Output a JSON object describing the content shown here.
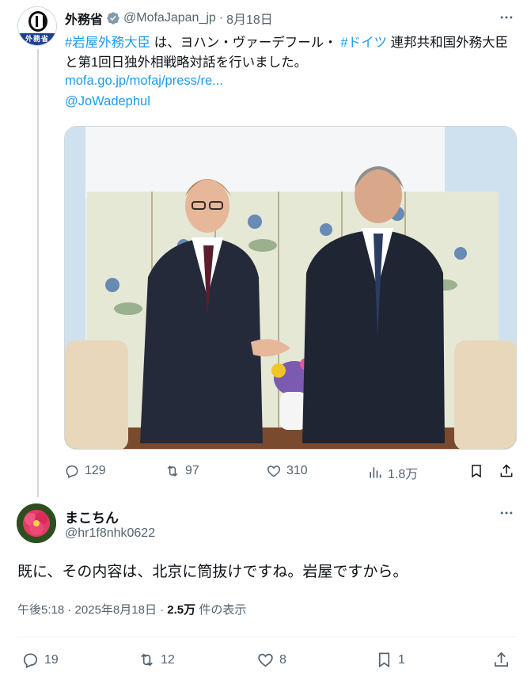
{
  "parent": {
    "author_name": "外務省",
    "handle": "@MofaJapan_jp",
    "separator": "·",
    "date": "8月18日",
    "avatar_caption": "外務省",
    "text_parts": {
      "hashtag1": "#岩屋外務大臣",
      "t1": " は、ヨハン・ヴァーデフール・ ",
      "hashtag2": "#ドイツ",
      "t2": " 連邦共和国外務大臣と第1回日独外相戦略対話を行いました。"
    },
    "link": "mofa.go.jp/mofaj/press/re...",
    "mention": "@JoWadephul",
    "stats": {
      "replies": "129",
      "reposts": "97",
      "likes": "310",
      "views": "1.8万"
    }
  },
  "reply": {
    "author_name": "まこちん",
    "handle": "@hr1f8nhk0622",
    "text": "既に、その内容は、北京に筒抜けですね。岩屋ですから。",
    "time": "午後5:18",
    "separator": "·",
    "date": "2025年8月18日",
    "views_count": "2.5万",
    "views_suffix": " 件の表示",
    "stats": {
      "replies": "19",
      "reposts": "12",
      "likes": "8",
      "bookmarks": "1"
    }
  },
  "colors": {
    "accent": "#1d9bf0",
    "secondary_text": "#536471",
    "primary_text": "#0f1419",
    "divider": "#eff3f4"
  }
}
